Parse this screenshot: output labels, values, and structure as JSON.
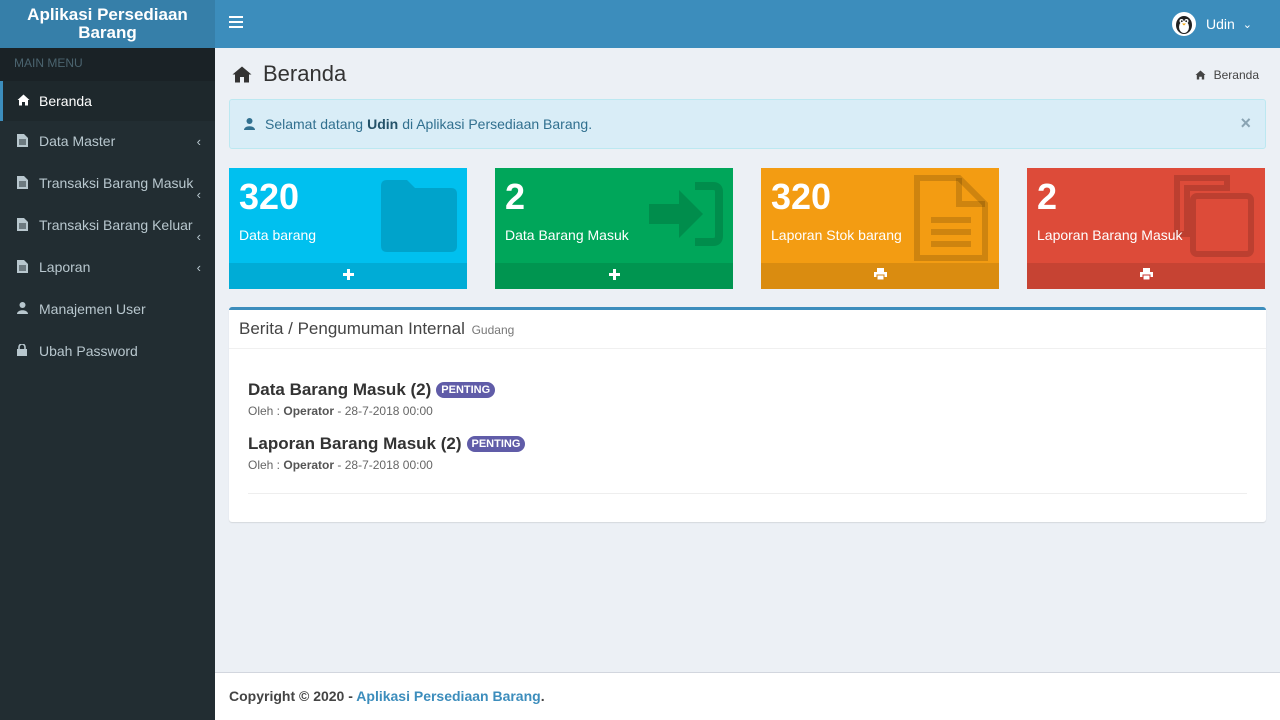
{
  "app": {
    "title": "Aplikasi Persediaan Barang"
  },
  "sidebar": {
    "header": "MAIN MENU",
    "items": [
      {
        "label": "Beranda",
        "icon": "home-icon",
        "active": true
      },
      {
        "label": "Data Master",
        "icon": "file-icon",
        "has_submenu": true
      },
      {
        "label": "Transaksi Barang Masuk",
        "icon": "file-icon",
        "has_submenu": true
      },
      {
        "label": "Transaksi Barang Keluar",
        "icon": "file-icon",
        "has_submenu": true
      },
      {
        "label": "Laporan",
        "icon": "file-icon",
        "has_submenu": true
      },
      {
        "label": "Manajemen User",
        "icon": "user-icon"
      },
      {
        "label": "Ubah Password",
        "icon": "lock-icon"
      }
    ]
  },
  "header": {
    "user_name": "Udin"
  },
  "page": {
    "title": "Beranda",
    "breadcrumb": "Beranda"
  },
  "alert": {
    "prefix": "Selamat datang",
    "user": "Udin",
    "suffix": "di Aplikasi Persediaan Barang.",
    "close": "×"
  },
  "boxes": [
    {
      "value": "320",
      "label": "Data barang",
      "color": "#00c0ef",
      "icon": "folder-icon",
      "footer_icon": "plus-icon"
    },
    {
      "value": "2",
      "label": "Data Barang Masuk",
      "color": "#00a65a",
      "icon": "sign-in-icon",
      "footer_icon": "plus-icon"
    },
    {
      "value": "320",
      "label": "Laporan Stok barang",
      "color": "#f39c12",
      "icon": "file-text-icon",
      "footer_icon": "print-icon"
    },
    {
      "value": "2",
      "label": "Laporan Barang Masuk",
      "color": "#dd4b39",
      "icon": "copy-icon",
      "footer_icon": "print-icon"
    }
  ],
  "news_panel": {
    "title": "Berita / Pengumuman Internal",
    "subtitle": "Gudang",
    "items": [
      {
        "title": "Data Barang Masuk (2)",
        "badge": "PENTING",
        "by_label": "Oleh :",
        "author": "Operator",
        "date": "- 28-7-2018 00:00"
      },
      {
        "title": "Laporan Barang Masuk (2)",
        "badge": "PENTING",
        "by_label": "Oleh :",
        "author": "Operator",
        "date": "- 28-7-2018 00:00"
      }
    ]
  },
  "footer": {
    "text": "Copyright © 2020 -",
    "link": "Aplikasi Persediaan Barang",
    "end": "."
  }
}
